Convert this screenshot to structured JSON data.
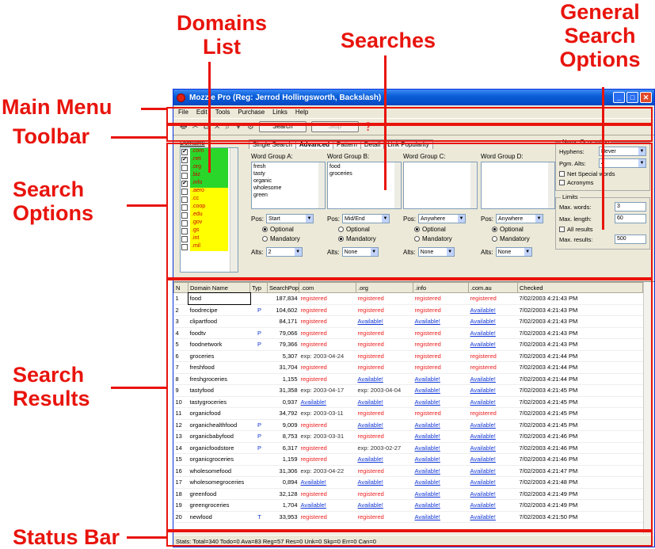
{
  "annotations": {
    "domains_list": "Domains\nList",
    "searches": "Searches",
    "general_search_options": "General\nSearch\nOptions",
    "main_menu": "Main Menu",
    "toolbar": "Toolbar",
    "search_options": "Search\nOptions",
    "search_results": "Search\nResults",
    "status_bar": "Status Bar"
  },
  "window": {
    "title": "Mozzle Pro (Reg: Jerrod Hollingsworth, Backslash)",
    "controls": [
      "_",
      "□",
      "✕"
    ]
  },
  "menu": [
    "File",
    "Edit",
    "Tools",
    "Purchase",
    "Links",
    "Help"
  ],
  "toolbar": {
    "search_label": "Search",
    "stop_label": "Stop"
  },
  "domains": {
    "label": "Domains",
    "items": [
      {
        "name": ".com",
        "checked": true,
        "color": "#2ad62a"
      },
      {
        "name": ".net",
        "checked": true,
        "color": "#2ad62a"
      },
      {
        "name": ".org",
        "checked": false,
        "color": "#2ad62a"
      },
      {
        "name": ".biz",
        "checked": false,
        "color": "#2ad62a"
      },
      {
        "name": ".info",
        "checked": true,
        "color": "#2ad62a"
      },
      {
        "name": ".aero",
        "checked": false,
        "color": "#ffff00"
      },
      {
        "name": ".cc",
        "checked": false,
        "color": "#ffff00"
      },
      {
        "name": ".coop",
        "checked": false,
        "color": "#ffff00"
      },
      {
        "name": ".edu",
        "checked": false,
        "color": "#ffff00"
      },
      {
        "name": ".gov",
        "checked": false,
        "color": "#ffff00"
      },
      {
        "name": ".gs",
        "checked": false,
        "color": "#ffff00"
      },
      {
        "name": ".int",
        "checked": false,
        "color": "#ffff00"
      },
      {
        "name": ".mil",
        "checked": false,
        "color": "#ffff00"
      }
    ]
  },
  "tabs": [
    "Single Search",
    "Advanced",
    "Pattern",
    "Detail",
    "Link Popularity"
  ],
  "word_groups": [
    {
      "label": "Word Group A:",
      "words": "fresh\ntasty\norganic\nwholesome\ngreen",
      "pos": "Start",
      "radio": "Optional",
      "alts": "2"
    },
    {
      "label": "Word Group B:",
      "words": "food\ngroceries",
      "pos": "Mid/End",
      "radio": "Mandatory",
      "alts": "None"
    },
    {
      "label": "Word Group C:",
      "words": "",
      "pos": "Anywhere",
      "radio": "Optional",
      "alts": "None"
    },
    {
      "label": "Word Group D:",
      "words": "",
      "pos": "Anywhere",
      "radio": "Optional",
      "alts": "None"
    }
  ],
  "labels": {
    "pos": "Pos:",
    "optional": "Optional",
    "mandatory": "Mandatory",
    "alts": "Alts:"
  },
  "general": {
    "name_generation": "Name Generation",
    "hyphens_label": "Hyphens:",
    "hyphens_value": "Never",
    "pgm_alts_label": "Pgm. Alts:",
    "pgm_alts_value": "4",
    "net_special": "Net Special words",
    "acronyms": "Acronyms",
    "limits": "Limits",
    "max_words_label": "Max. words:",
    "max_words_value": "3",
    "max_length_label": "Max. length:",
    "max_length_value": "60",
    "all_results": "All results",
    "max_results_label": "Max. results:",
    "max_results_value": "500"
  },
  "results": {
    "columns": [
      "N",
      "Domain Name",
      "Typ",
      "SearchPop",
      ".com",
      ".org",
      ".info",
      ".com.au",
      "Checked"
    ],
    "rows": [
      [
        "1",
        "food",
        "",
        "187,834",
        "registered",
        "registered",
        "registered",
        "registered",
        "7/02/2003 4:21:43 PM"
      ],
      [
        "2",
        "foodrecipe",
        "P",
        "104,602",
        "registered",
        "registered",
        "registered",
        "Available!",
        "7/02/2003 4:21:43 PM"
      ],
      [
        "3",
        "clipartfood",
        "",
        "84,171",
        "registered",
        "Available!",
        "Available!",
        "Available!",
        "7/02/2003 4:21:43 PM"
      ],
      [
        "4",
        "foodtv",
        "P",
        "79,066",
        "registered",
        "registered",
        "registered",
        "Available!",
        "7/02/2003 4:21:43 PM"
      ],
      [
        "5",
        "foodnetwork",
        "P",
        "79,366",
        "registered",
        "registered",
        "registered",
        "Available!",
        "7/02/2003 4:21:43 PM"
      ],
      [
        "6",
        "groceries",
        "",
        "5,307",
        "exp: 2003-04-24",
        "registered",
        "registered",
        "registered",
        "7/02/2003 4:21:44 PM"
      ],
      [
        "7",
        "freshfood",
        "",
        "31,704",
        "registered",
        "registered",
        "registered",
        "registered",
        "7/02/2003 4:21:44 PM"
      ],
      [
        "8",
        "freshgroceries",
        "",
        "1,155",
        "registered",
        "Available!",
        "Available!",
        "Available!",
        "7/02/2003 4:21:44 PM"
      ],
      [
        "9",
        "tastyfood",
        "",
        "31,358",
        "exp: 2003-04-17",
        "exp: 2003-04-04",
        "Available!",
        "Available!",
        "7/02/2003 4:21:45 PM"
      ],
      [
        "10",
        "tastygroceries",
        "",
        "0,937",
        "Available!",
        "Available!",
        "Available!",
        "Available!",
        "7/02/2003 4:21:45 PM"
      ],
      [
        "11",
        "organicfood",
        "",
        "34,792",
        "exp: 2003-03-11",
        "registered",
        "registered",
        "registered",
        "7/02/2003 4:21:45 PM"
      ],
      [
        "12",
        "organichealthfood",
        "P",
        "9,009",
        "registered",
        "Available!",
        "Available!",
        "Available!",
        "7/02/2003 4:21:45 PM"
      ],
      [
        "13",
        "organicbabyfood",
        "P",
        "8,753",
        "exp: 2003-03-31",
        "registered",
        "Available!",
        "Available!",
        "7/02/2003 4:21:46 PM"
      ],
      [
        "14",
        "organicfoodstore",
        "P",
        "6,317",
        "registered",
        "exp: 2003-02-27",
        "Available!",
        "Available!",
        "7/02/2003 4:21:46 PM"
      ],
      [
        "15",
        "organicgroceries",
        "",
        "1,159",
        "registered",
        "Available!",
        "Available!",
        "Available!",
        "7/02/2003 4:21:46 PM"
      ],
      [
        "16",
        "wholesomefood",
        "",
        "31,306",
        "exp: 2003-04-22",
        "registered",
        "Available!",
        "Available!",
        "7/02/2003 4:21:47 PM"
      ],
      [
        "17",
        "wholesomegroceries",
        "",
        "0,894",
        "Available!",
        "Available!",
        "Available!",
        "Available!",
        "7/02/2003 4:21:48 PM"
      ],
      [
        "18",
        "greenfood",
        "",
        "32,128",
        "registered",
        "registered",
        "Available!",
        "Available!",
        "7/02/2003 4:21:49 PM"
      ],
      [
        "19",
        "greengroceries",
        "",
        "1,704",
        "Available!",
        "Available!",
        "Available!",
        "Available!",
        "7/02/2003 4:21:49 PM"
      ],
      [
        "20",
        "newfood",
        "T",
        "33,953",
        "registered",
        "registered",
        "Available!",
        "Available!",
        "7/02/2003 4:21:50 PM"
      ]
    ]
  },
  "status": "Stats: Total=340 Todo=0 Ava=83 Reg=57 Res=0 Unk=0 Skp=0 Err=0 Can=0"
}
